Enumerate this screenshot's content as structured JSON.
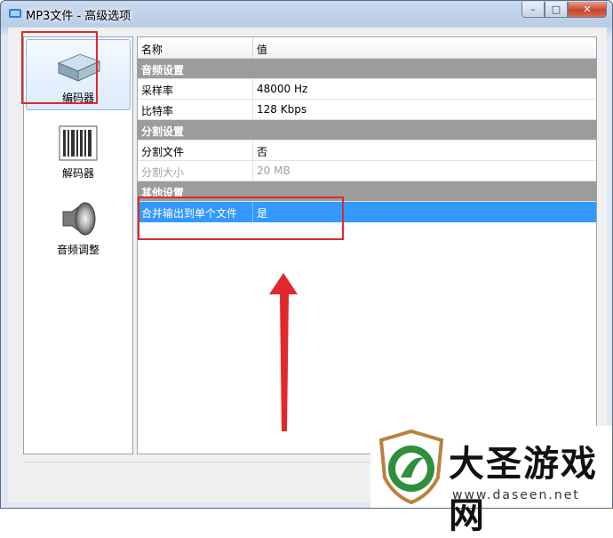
{
  "window": {
    "title": "MP3文件 - 高级选项",
    "controls": {
      "minimize": "–",
      "maximize": "□",
      "close": "✕"
    }
  },
  "sidebar": {
    "items": [
      {
        "label": "编码器",
        "icon": "encoder-box-icon",
        "selected": true
      },
      {
        "label": "解码器",
        "icon": "decoder-barcode-icon",
        "selected": false
      },
      {
        "label": "音频调整",
        "icon": "speaker-icon",
        "selected": false
      }
    ]
  },
  "properties": {
    "columns": {
      "name": "名称",
      "value": "值"
    },
    "rows": [
      {
        "type": "group",
        "label": "音频设置"
      },
      {
        "type": "item",
        "label": "采样率",
        "value": "48000 Hz"
      },
      {
        "type": "item",
        "label": "比特率",
        "value": "128 Kbps"
      },
      {
        "type": "group",
        "label": "分割设置"
      },
      {
        "type": "item",
        "label": "分割文件",
        "value": "否"
      },
      {
        "type": "disabled",
        "label": "分割大小",
        "value": "20 MB"
      },
      {
        "type": "group",
        "label": "其他设置"
      },
      {
        "type": "selected",
        "label": "合并输出到单个文件",
        "value": "是"
      }
    ]
  },
  "annotation": {
    "color": "#e0282d"
  },
  "watermark": {
    "name": "大圣游戏网",
    "url": "www.daseen.net"
  },
  "colors": {
    "selection": "#3399ff",
    "group_header": "#9c9c9c"
  }
}
